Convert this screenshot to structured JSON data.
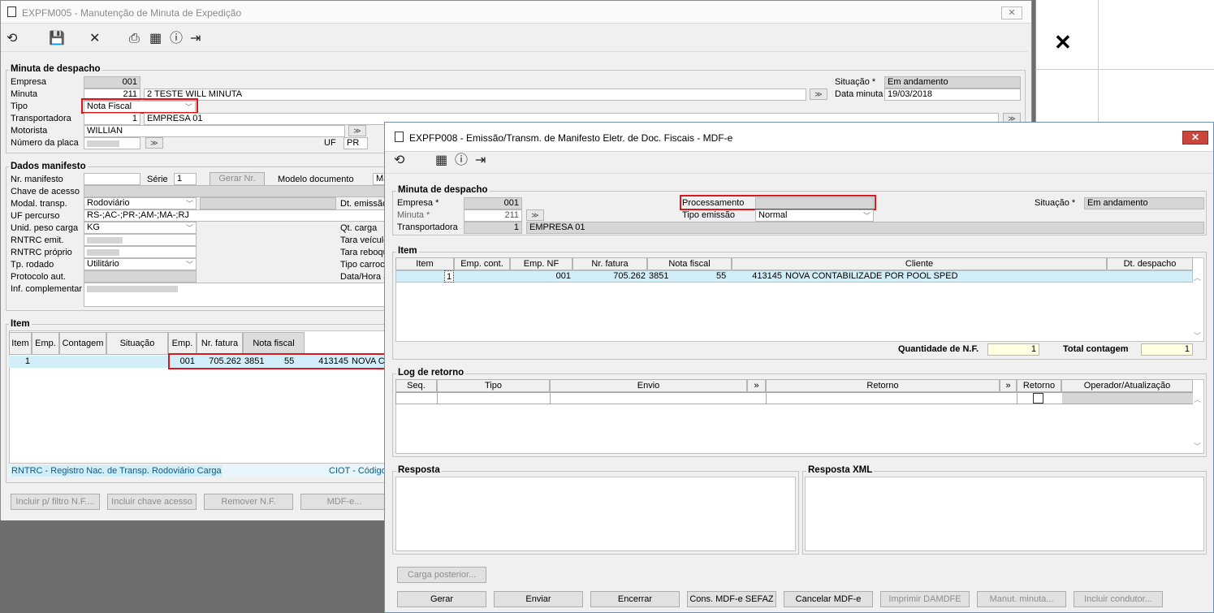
{
  "back_window": {
    "title": "EXPFM005 - Manutenção de Minuta de Expedição",
    "toolbar": {
      "refresh": "refresh-icon",
      "save": "save-icon",
      "close": "close-icon",
      "print": "print-icon",
      "calendar": "calendar-icon",
      "help": "help-icon",
      "exit": "exit-icon"
    },
    "minuta": {
      "section": "Minuta de despacho",
      "empresa_label": "Empresa",
      "empresa_value": "001",
      "minuta_label": "Minuta",
      "minuta_value": "211",
      "minuta_desc": "2 TESTE WILL MINUTA",
      "tipo_label": "Tipo",
      "tipo_value": "Nota Fiscal",
      "transp_label": "Transportadora",
      "transp_code": "1",
      "transp_name": "EMPRESA 01",
      "motorista_label": "Motorista",
      "motorista_value": "WILLIAN",
      "placa_label": "Número da placa",
      "uf_label": "UF",
      "uf_value": "PR",
      "situacao_label": "Situação *",
      "situacao_value": "Em andamento",
      "data_label": "Data minuta",
      "data_value": "19/03/2018"
    },
    "dados": {
      "section": "Dados manifesto",
      "nr_label": "Nr. manifesto",
      "serie_label": "Série",
      "serie_value": "1",
      "gerar_btn": "Gerar Nr.",
      "modelo_label": "Modelo documento",
      "modelo_value": "Ma",
      "chave_label": "Chave de acesso",
      "modal_label": "Modal. transp.",
      "modal_value": "Rodoviário",
      "dtemissao_label": "Dt. emissão",
      "ufp_label": "UF percurso",
      "ufp_value": "RS-;AC-;PR-;AM-;MA-;RJ",
      "unid_label": "Unid. peso carga",
      "unid_value": "KG",
      "qt_label": "Qt. carga",
      "rntrc_emit_label": "RNTRC emit.",
      "tara_label": "Tara veículo",
      "rntrc_prop_label": "RNTRC próprio",
      "tara_reb_label": "Tara reboque",
      "tprod_label": "Tp. rodado",
      "tprod_value": "Utilitário",
      "tipo_carroc_label": "Tipo carroc",
      "protocolo_label": "Protocolo aut.",
      "datahora_label": "Data/Hora a",
      "inf_label": "Inf. complementar"
    },
    "item": {
      "section": "Item",
      "columns": [
        "Item",
        "Emp.",
        "Contagem",
        "Situação",
        "Emp.",
        "Nr. fatura",
        "Nota fiscal"
      ],
      "row": {
        "item": "1",
        "emp": "001",
        "fatura": "705.262",
        "nf": "3851",
        "modelo": "55",
        "cliente_code": "413145",
        "cliente": "NOVA C"
      }
    },
    "footer": {
      "rntrc": "RNTRC - Registro Nac. de Transp. Rodoviário Carga",
      "ciot": "CIOT - Código"
    },
    "buttons": [
      "Incluir p/ filtro N.F....",
      "Incluir chave acesso",
      "Remover N.F.",
      "MDF-e..."
    ]
  },
  "right_panel": {
    "close": "close-x-icon"
  },
  "front_window": {
    "title": "EXPFP008 - Emissão/Transm. de Manifesto Eletr. de Doc. Fiscais - MDF-e",
    "minuta": {
      "section": "Minuta de despacho",
      "empresa_label": "Empresa *",
      "empresa_value": "001",
      "minuta_label": "Minuta *",
      "minuta_value": "211",
      "transp_label": "Transportadora",
      "transp_code": "1",
      "transp_name": "EMPRESA 01",
      "proc_label": "Processamento",
      "tipo_emissao_label": "Tipo emissão",
      "tipo_emissao_value": "Normal",
      "situacao_label": "Situação *",
      "situacao_value": "Em andamento"
    },
    "item": {
      "section": "Item",
      "columns": [
        "Item",
        "Emp. cont.",
        "Emp. NF",
        "Nr. fatura",
        "Nota fiscal",
        "Cliente",
        "Dt. despacho"
      ],
      "row": {
        "item": "1",
        "emp_nf": "001",
        "fatura": "705.262",
        "nf": "3851",
        "modelo": "55",
        "cliente_code": "413145",
        "cliente": "NOVA CONTABILIZADE POR POOL SPED"
      },
      "qtd_label": "Quantidade de N.F.",
      "qtd_value": "1",
      "total_label": "Total contagem",
      "total_value": "1"
    },
    "log": {
      "section": "Log de retorno",
      "columns": [
        "Seq.",
        "Tipo",
        "Envio",
        "»",
        "Retorno",
        "»",
        "Retorno",
        "Operador/Atualização"
      ]
    },
    "resposta": {
      "section": "Resposta"
    },
    "resposta_xml": {
      "section": "Resposta XML"
    },
    "carga_btn": "Carga posterior...",
    "buttons": [
      "Gerar",
      "Enviar",
      "Encerrar",
      "Cons. MDF-e SEFAZ",
      "Cancelar MDF-e",
      "Imprimir DAMDFE",
      "Manut. minuta...",
      "Incluir condutor..."
    ]
  }
}
